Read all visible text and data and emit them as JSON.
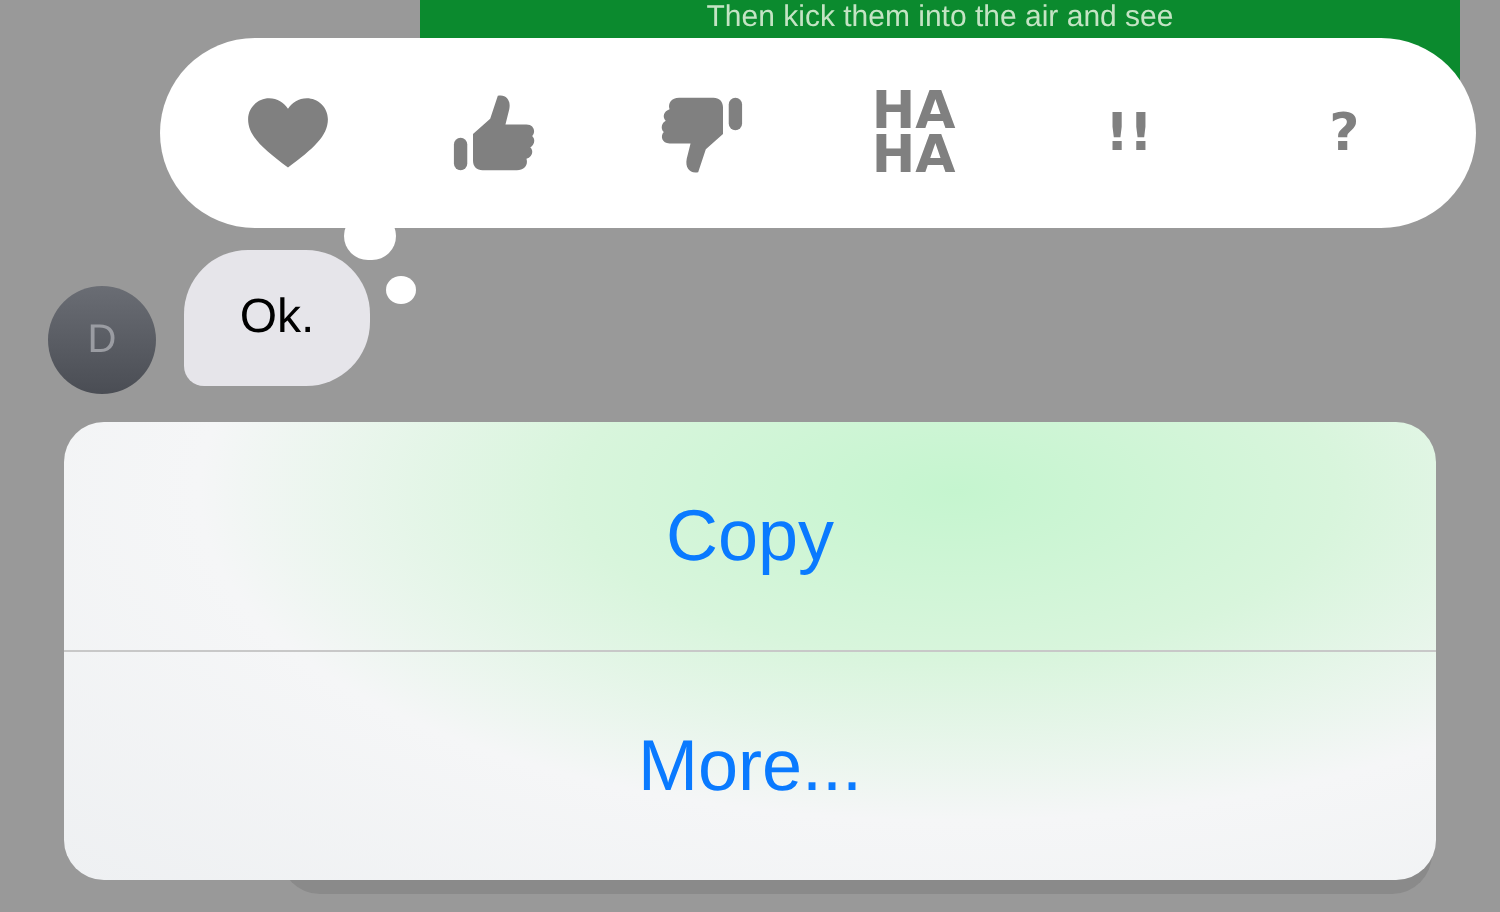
{
  "sent_message": {
    "text": "Then kick them into the air and see"
  },
  "tapbacks": [
    {
      "kind": "heart"
    },
    {
      "kind": "thumbs-up"
    },
    {
      "kind": "thumbs-down"
    },
    {
      "kind": "text",
      "label": "HA HA"
    },
    {
      "kind": "text",
      "label": "!!"
    },
    {
      "kind": "text",
      "label": "?"
    }
  ],
  "received_message": {
    "avatar": "D",
    "text": "Ok."
  },
  "actions": [
    "Copy",
    "More..."
  ]
}
